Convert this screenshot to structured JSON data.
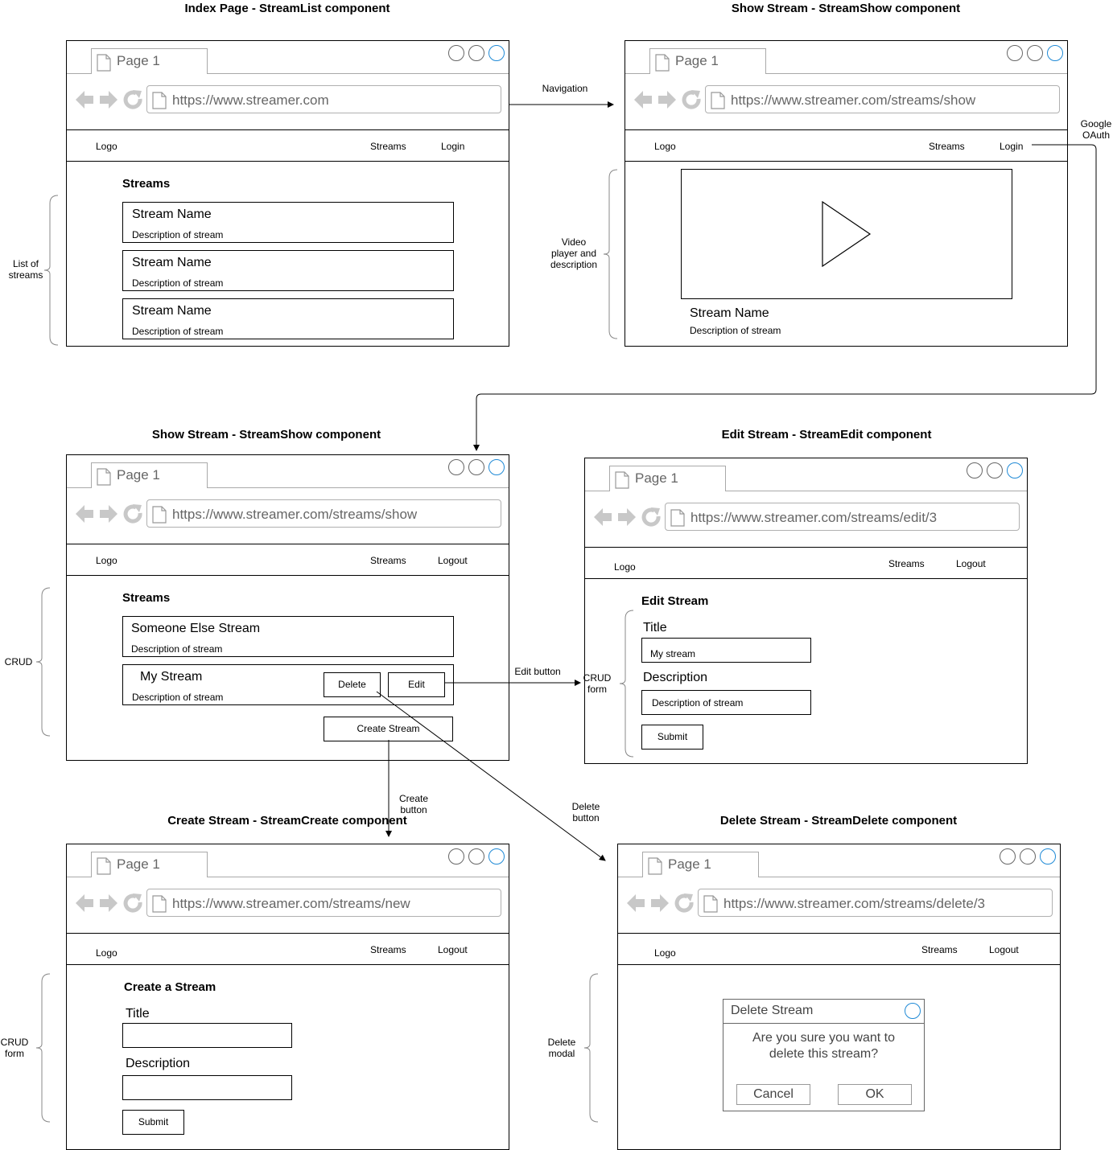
{
  "titles": {
    "index": "Index Page - StreamList component",
    "show1": "Show Stream - StreamShow component",
    "show2": "Show Stream - StreamShow component",
    "edit": "Edit Stream - StreamEdit component",
    "create": "Create Stream - StreamCreate component",
    "delete": "Delete Stream - StreamDelete component"
  },
  "browser": {
    "tab_label": "Page 1"
  },
  "urls": {
    "index": "https://www.streamer.com",
    "show": "https://www.streamer.com/streams/show",
    "edit": "https://www.streamer.com/streams/edit/3",
    "create": "https://www.streamer.com/streams/new",
    "delete": "https://www.streamer.com/streams/delete/3"
  },
  "nav": {
    "logo": "Logo",
    "streams": "Streams",
    "login": "Login",
    "logout": "Logout"
  },
  "index_page": {
    "heading": "Streams",
    "items": [
      {
        "name": "Stream Name",
        "desc": "Description of stream"
      },
      {
        "name": "Stream Name",
        "desc": "Description of stream"
      },
      {
        "name": "Stream Name",
        "desc": "Description of stream"
      }
    ]
  },
  "show_page": {
    "stream_name": "Stream Name",
    "stream_desc": "Description of stream"
  },
  "show_auth_page": {
    "heading": "Streams",
    "item1_name": "Someone Else Stream",
    "item1_desc": "Description of stream",
    "item2_name": "My Stream",
    "item2_desc": "Description of stream",
    "delete_label": "Delete",
    "edit_label": "Edit",
    "create_label": "Create Stream"
  },
  "edit_page": {
    "heading": "Edit Stream",
    "title_label": "Title",
    "title_value": "My stream",
    "desc_label": "Description",
    "desc_value": "Description of stream",
    "submit_label": "Submit"
  },
  "create_page": {
    "heading": "Create a Stream",
    "title_label": "Title",
    "desc_label": "Description",
    "submit_label": "Submit"
  },
  "delete_page": {
    "modal_title": "Delete Stream",
    "message_line1": "Are you sure you want to",
    "message_line2": "delete this stream?",
    "cancel_label": "Cancel",
    "ok_label": "OK"
  },
  "annotations": {
    "list_of_streams_1": "List of",
    "list_of_streams_2": "streams",
    "video_1": "Video",
    "video_2": "player and",
    "video_3": "description",
    "crud": "CRUD",
    "crud_form_1": "CRUD",
    "crud_form_2": "form",
    "crud_form_left_1": "CRUD",
    "crud_form_left_2": "form",
    "delete_modal_1": "Delete",
    "delete_modal_2": "modal",
    "navigation": "Navigation",
    "google_1": "Google",
    "google_2": "OAuth",
    "edit_button": "Edit button",
    "create_button_1": "Create",
    "create_button_2": "button",
    "delete_button_1": "Delete",
    "delete_button_2": "button"
  }
}
